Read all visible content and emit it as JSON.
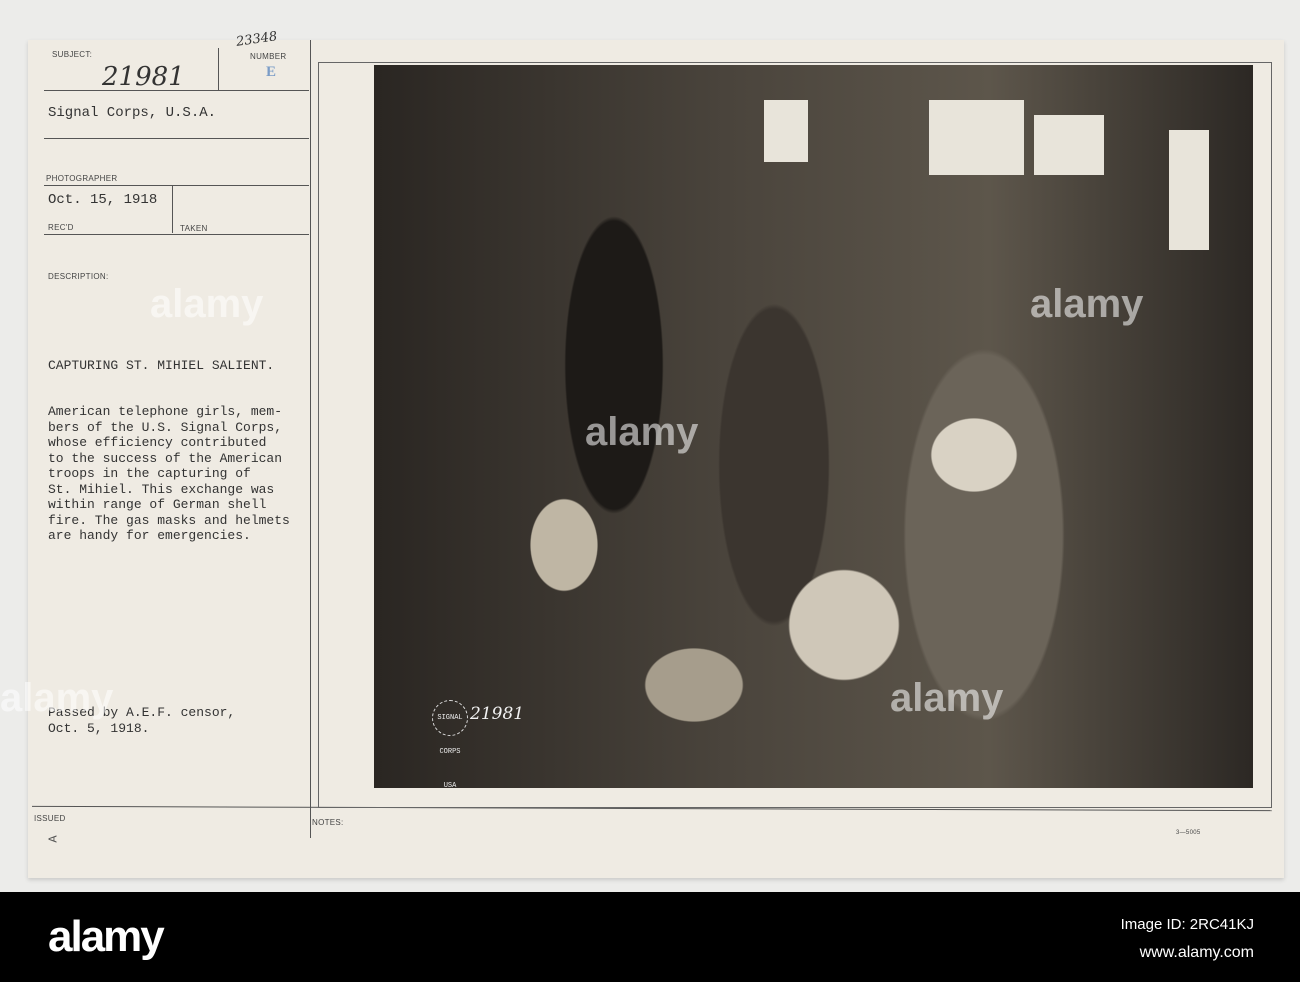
{
  "card": {
    "subject_label": "SUBJECT:",
    "subject_number": "21981",
    "handwritten_note": "23348",
    "number_label": "NUMBER",
    "number_stamp": "E",
    "unit": "Signal Corps, U.S.A.",
    "photographer_label": "PHOTOGRAPHER",
    "received_date": "Oct. 15, 1918",
    "recd_label": "REC'D",
    "taken_label": "TAKEN",
    "description_label": "DESCRIPTION:",
    "title": "CAPTURING ST. MIHIEL SALIENT.",
    "description_lines": [
      "American telephone girls, mem-",
      "bers of the U.S. Signal Corps,",
      "whose efficiency contributed",
      "to the success of the American",
      "troops in the capturing of",
      "St. Mihiel. This exchange was",
      "within range of German shell",
      "fire. The gas masks and helmets",
      "are handy for emergencies."
    ],
    "censor_lines": [
      "Passed by A.E.F. censor,",
      "Oct. 5, 1918."
    ],
    "issued_label": "ISSUED",
    "issued_mark": "A",
    "notes_label": "NOTES:",
    "form_number": "3—5005"
  },
  "photo": {
    "stamp_text": "SIGNAL CORPS USA",
    "photo_number": "21981"
  },
  "footer": {
    "logo": "alamy",
    "image_id": "Image ID: 2RC41KJ",
    "website": "www.alamy.com"
  },
  "watermark": "alamy"
}
